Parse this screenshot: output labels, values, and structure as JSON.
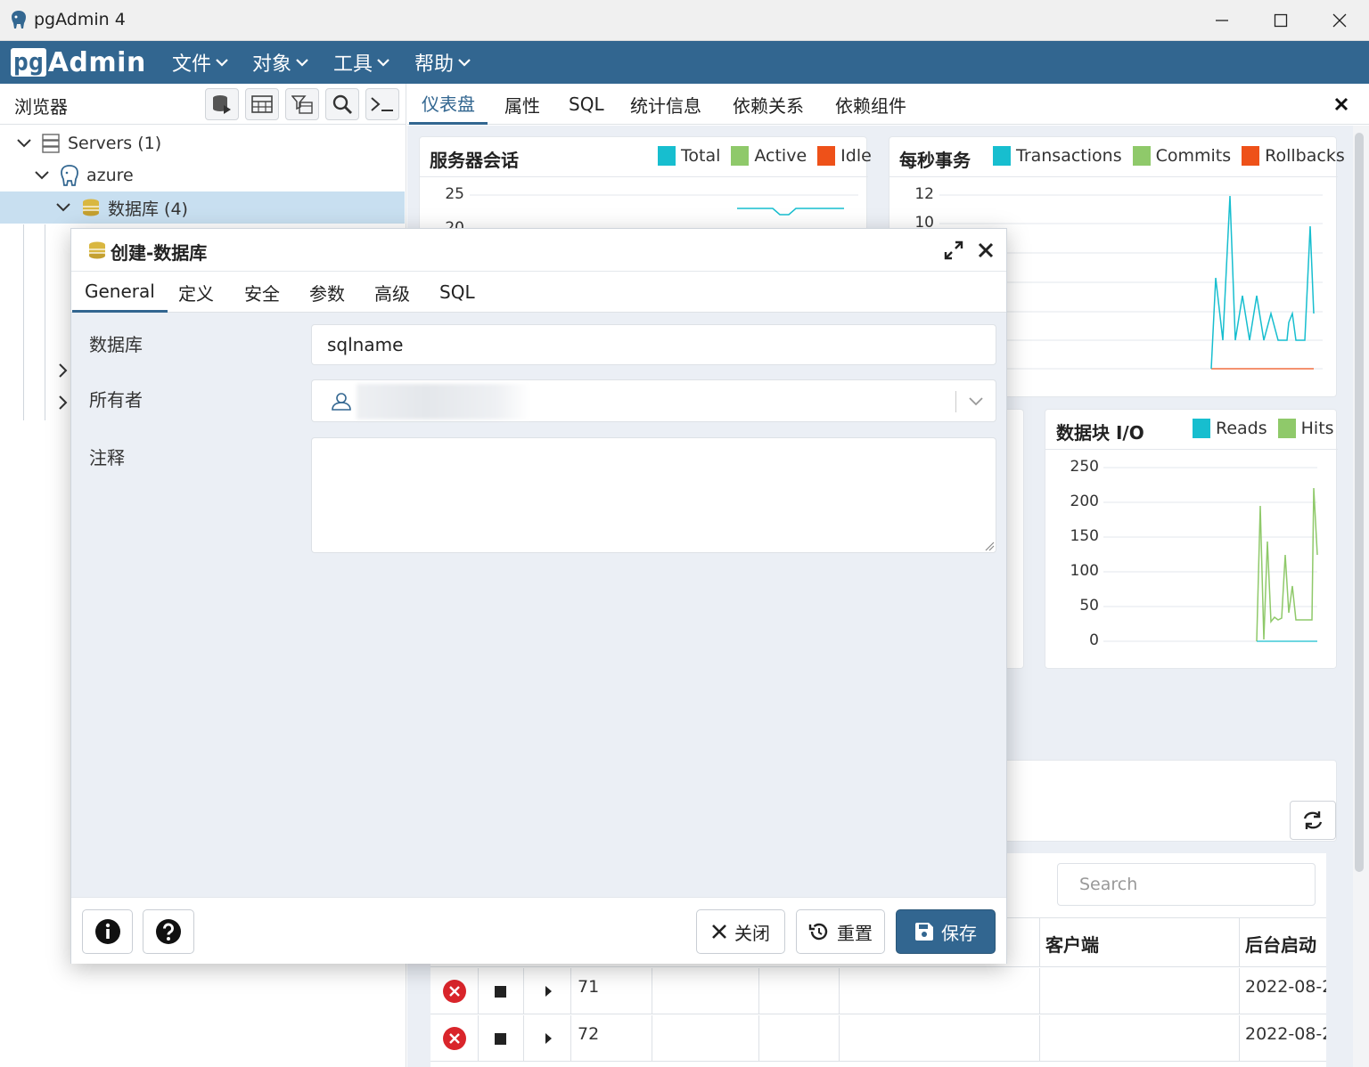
{
  "window": {
    "title": "pgAdmin 4"
  },
  "menubar": {
    "logo_pg": "pg",
    "logo_admin": "Admin",
    "items": [
      {
        "label": "文件"
      },
      {
        "label": "对象"
      },
      {
        "label": "工具"
      },
      {
        "label": "帮助"
      }
    ]
  },
  "browser": {
    "title": "浏览器",
    "tree": [
      {
        "label": "Servers (1)"
      },
      {
        "label": "azure"
      },
      {
        "label": "数据库 (4)"
      }
    ]
  },
  "main_tabs": [
    {
      "label": "仪表盘"
    },
    {
      "label": "属性"
    },
    {
      "label": "SQL"
    },
    {
      "label": "统计信息"
    },
    {
      "label": "依赖关系"
    },
    {
      "label": "依赖组件"
    }
  ],
  "dashboard": {
    "sessions": {
      "title": "服务器会话",
      "legend": [
        "Total",
        "Active",
        "Idle"
      ],
      "ticks": [
        "25",
        "20"
      ]
    },
    "transactions": {
      "title": "每秒事务",
      "legend": [
        "Transactions",
        "Commits",
        "Rollbacks"
      ],
      "ticks": [
        "12",
        "10"
      ]
    },
    "blockio": {
      "title": "数据块 I/O",
      "legend": [
        "Reads",
        "Hits"
      ],
      "ticks": [
        "250",
        "200",
        "150",
        "100",
        "50",
        "0"
      ]
    },
    "search_placeholder": "Search",
    "table": {
      "headers": [
        "客户端",
        "后台启动"
      ],
      "rows": [
        {
          "pid": "71",
          "start": "2022-08-2"
        },
        {
          "pid": "72",
          "start": "2022-08-2"
        }
      ]
    }
  },
  "colors": {
    "accent": "#326690",
    "total": "#17becf",
    "active": "#8fc96a",
    "idle": "#ee5119"
  },
  "dialog": {
    "title": "创建-数据库",
    "tabs": [
      {
        "label": "General"
      },
      {
        "label": "定义"
      },
      {
        "label": "安全"
      },
      {
        "label": "参数"
      },
      {
        "label": "高级"
      },
      {
        "label": "SQL"
      }
    ],
    "fields": {
      "database_label": "数据库",
      "database_value": "sqlname",
      "owner_label": "所有者",
      "comment_label": "注释"
    },
    "buttons": {
      "close": "关闭",
      "reset": "重置",
      "save": "保存"
    }
  }
}
